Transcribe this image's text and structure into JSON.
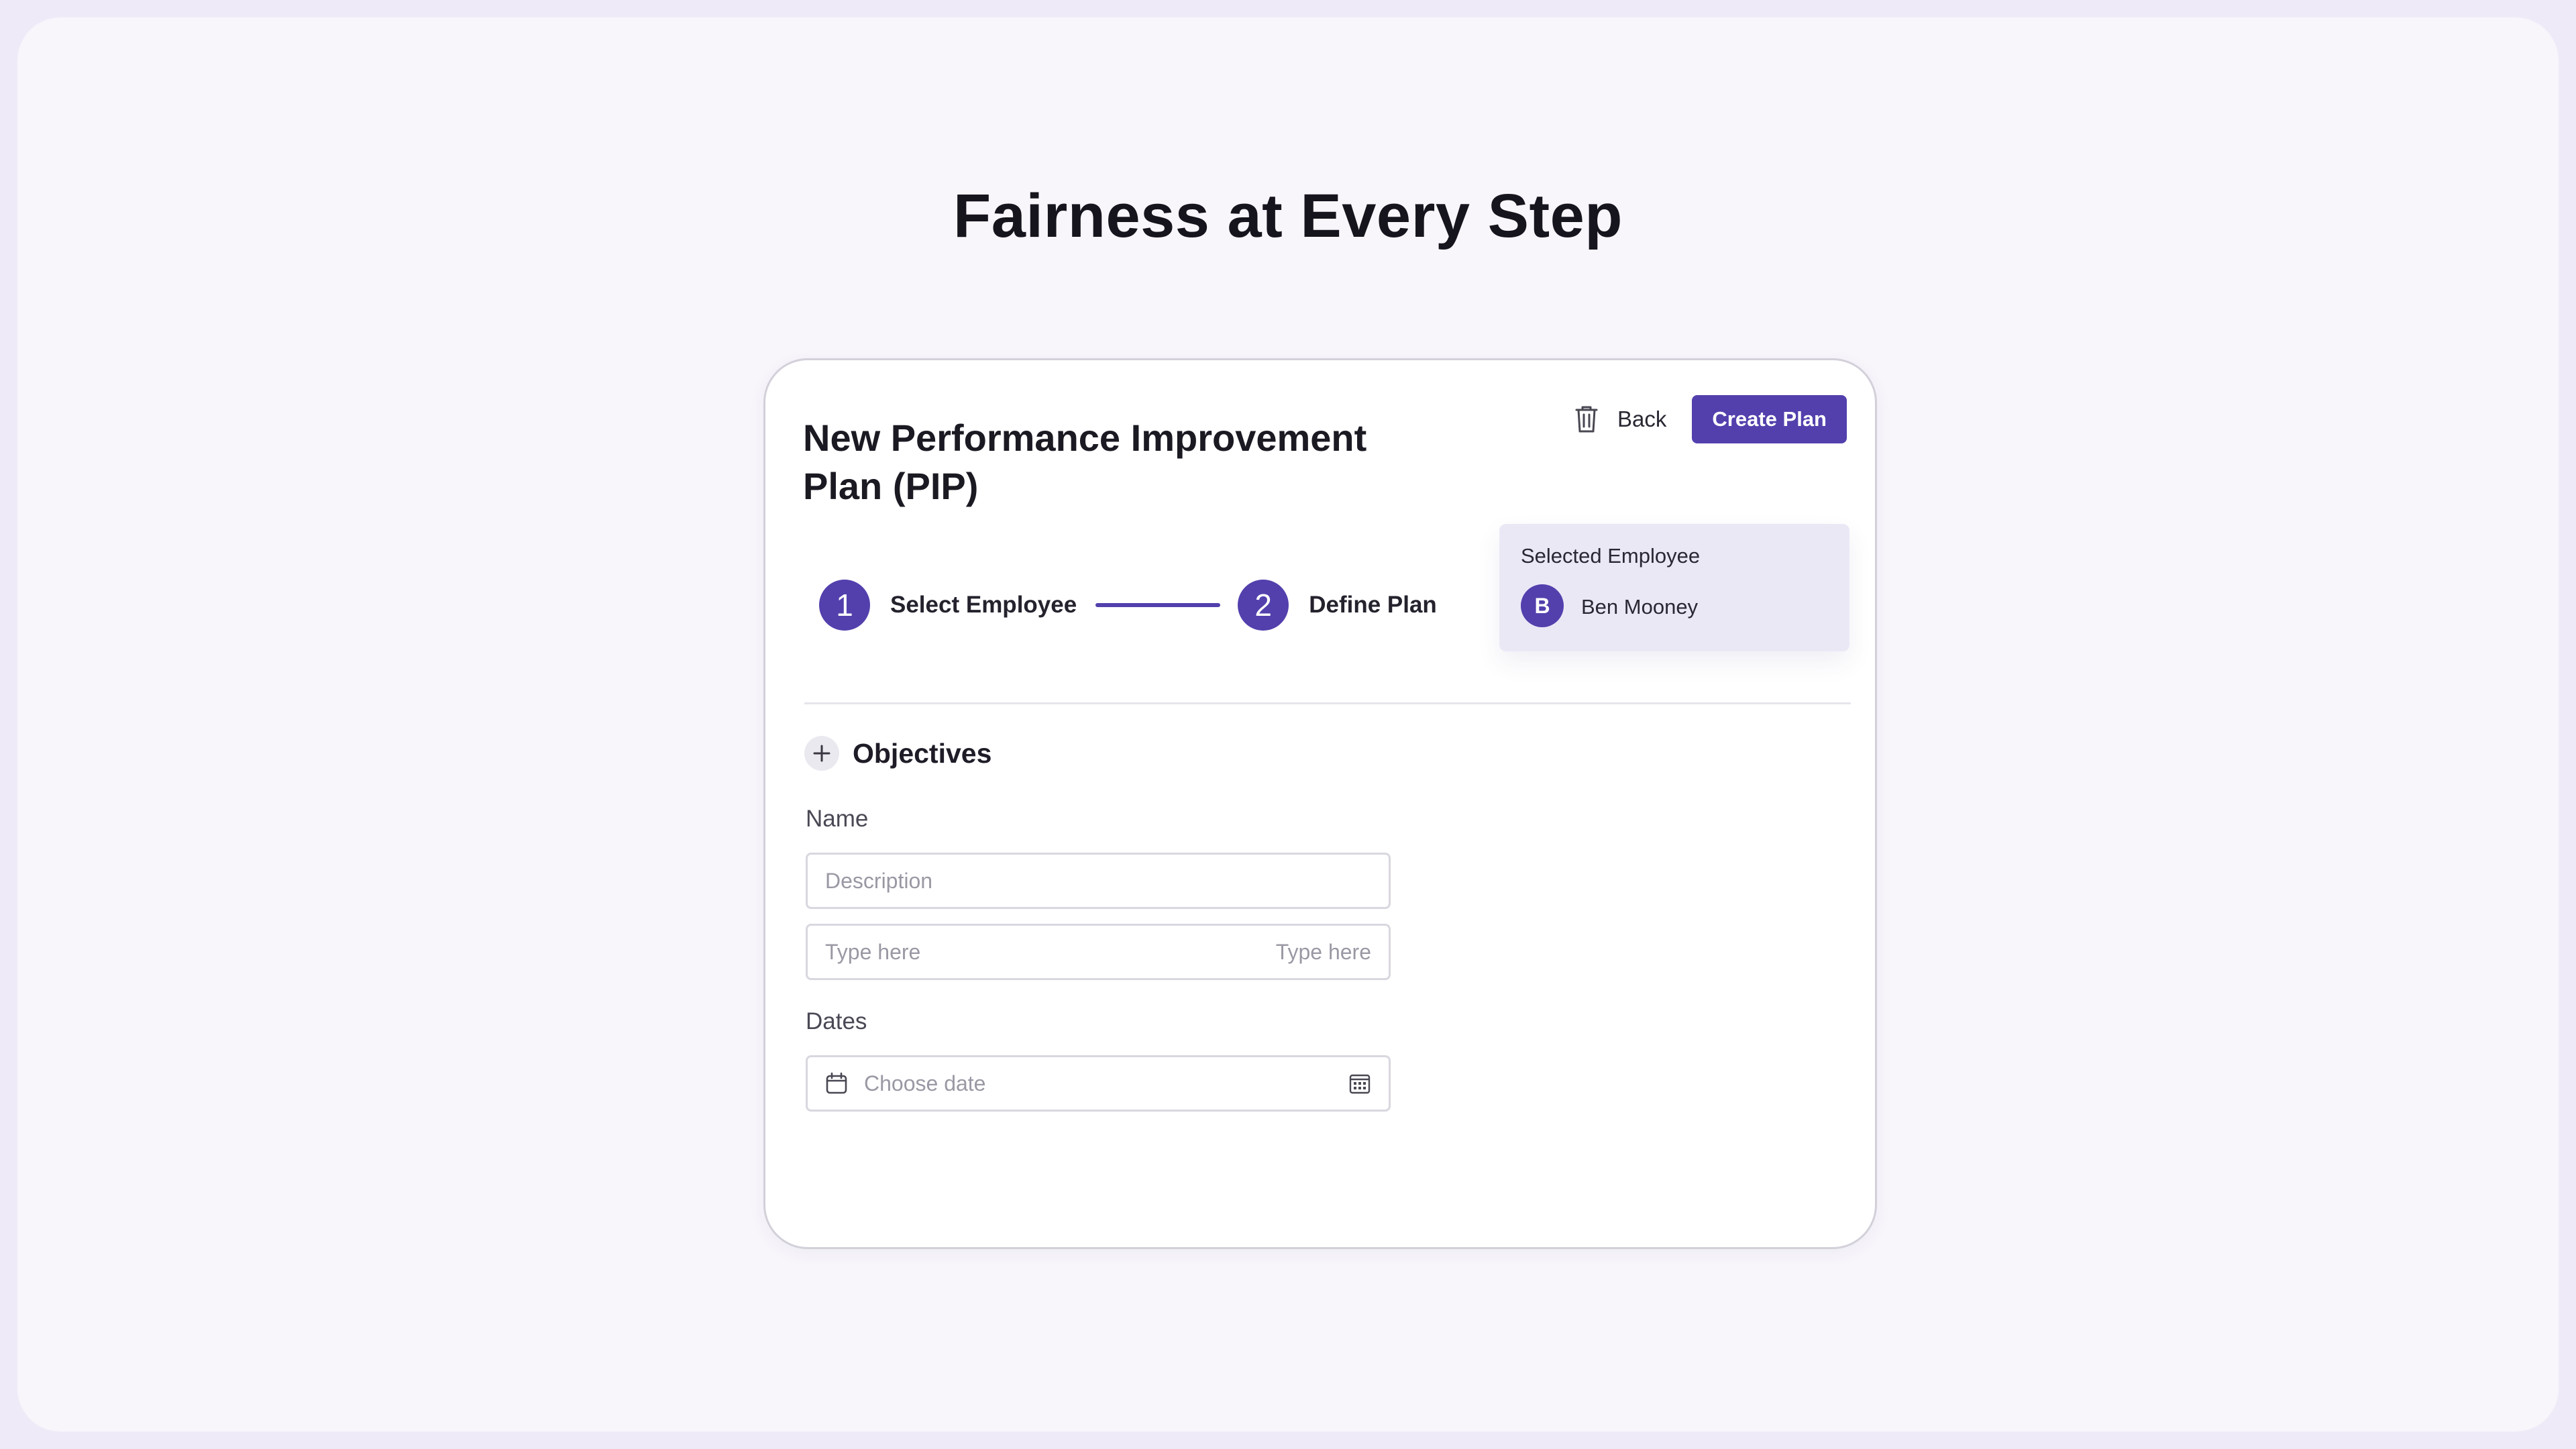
{
  "hero": {
    "title": "Fairness at Every Step"
  },
  "card": {
    "title": "New Performance Improvement Plan (PIP)",
    "actions": {
      "delete_icon": "trash-icon",
      "back_label": "Back",
      "create_label": "Create Plan"
    },
    "stepper": {
      "steps": [
        {
          "number": "1",
          "label": "Select Employee"
        },
        {
          "number": "2",
          "label": "Define Plan"
        }
      ]
    },
    "selected_employee": {
      "label": "Selected Employee",
      "avatar_initial": "B",
      "name": "Ben Mooney"
    },
    "objectives": {
      "title": "Objectives",
      "add_icon": "plus-icon",
      "name_label": "Name",
      "description_placeholder": "Description",
      "type_here_left": "Type here",
      "type_here_right": "Type here",
      "dates_label": "Dates",
      "date_placeholder": "Choose date"
    }
  },
  "colors": {
    "accent": "#5340ad",
    "page_bg": "#f8f6fb",
    "employee_card_bg": "#ebe8f6"
  }
}
